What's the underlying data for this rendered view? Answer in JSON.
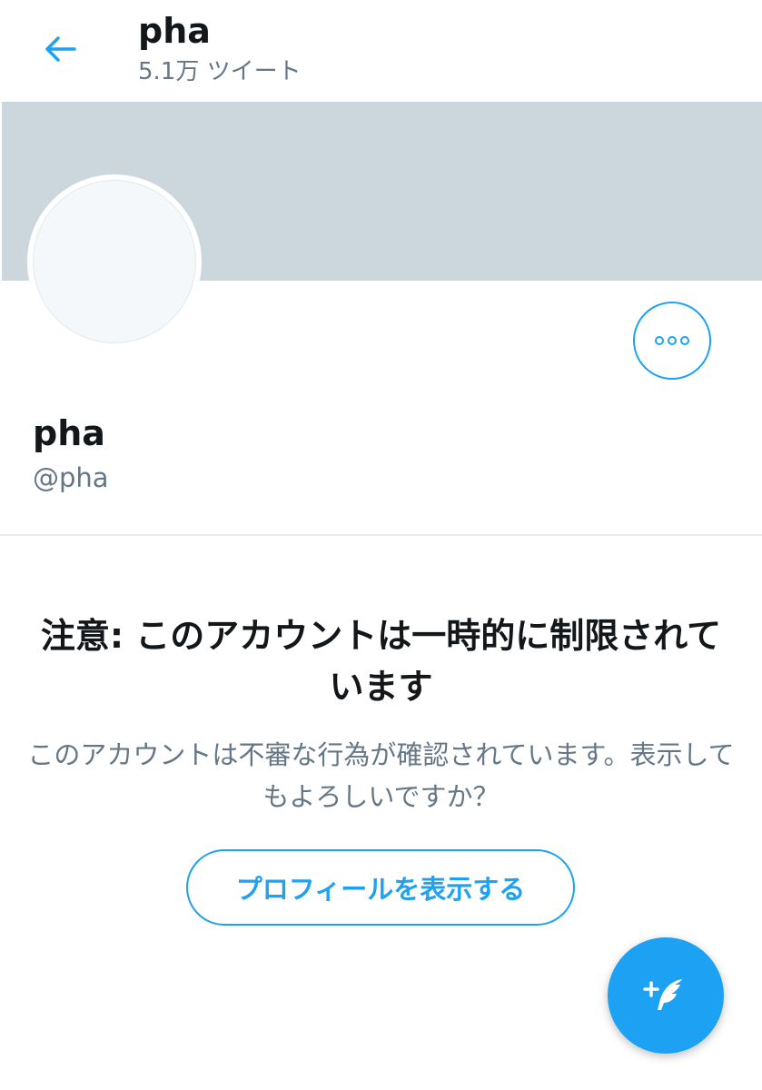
{
  "header": {
    "title": "pha",
    "subtitle": "5.1万 ツイート"
  },
  "profile": {
    "name": "pha",
    "handle": "@pha"
  },
  "warning": {
    "title": "注意: このアカウントは一時的に制限されています",
    "message": "このアカウントは不審な行為が確認されています。表示してもよろしいですか？",
    "button_label": "プロフィールを表示する"
  },
  "icons": {
    "back": "arrow-left-icon",
    "more": "more-horizontal-icon",
    "compose": "compose-tweet-icon"
  },
  "colors": {
    "accent": "#1da1f2",
    "banner": "#ccd6dd",
    "text_primary": "#14171a",
    "text_secondary": "#657786"
  }
}
